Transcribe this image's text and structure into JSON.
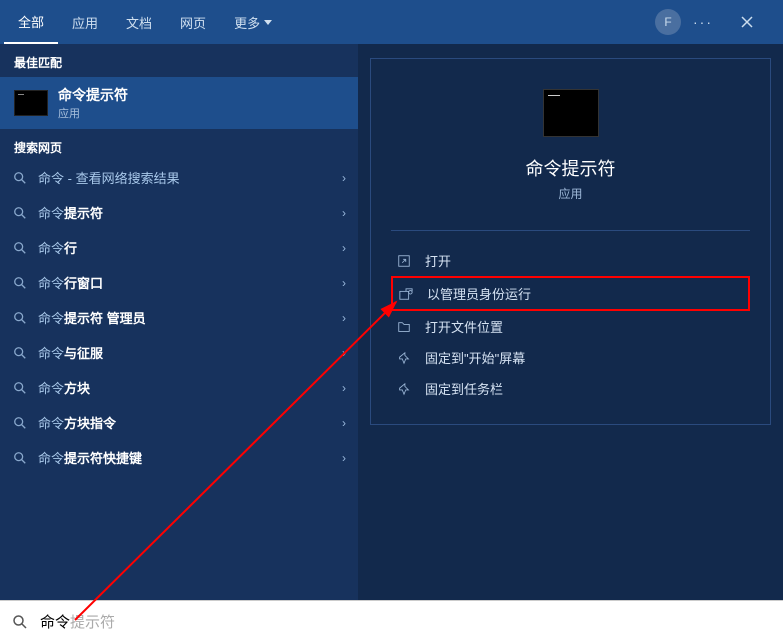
{
  "tabs": [
    "全部",
    "应用",
    "文档",
    "网页",
    "更多"
  ],
  "avatar": "F",
  "left": {
    "best_match_hdr": "最佳匹配",
    "bm_title": "命令提示符",
    "bm_sub": "应用",
    "web_hdr": "搜索网页",
    "items": [
      {
        "pre": "",
        "bold": "命令",
        "post": " - 查看网络搜索结果"
      },
      {
        "pre": "",
        "bold": "命令",
        "post": "",
        "suffix": "提示符",
        "suffix_bold": true
      },
      {
        "pre": "",
        "bold": "命令",
        "post": "",
        "suffix": "行",
        "suffix_bold": true
      },
      {
        "pre": "",
        "bold": "命令",
        "post": "",
        "suffix": "行窗口",
        "suffix_bold": true
      },
      {
        "pre": "",
        "bold": "命令",
        "post": "",
        "suffix": "提示符 管理员",
        "suffix_bold": true
      },
      {
        "pre": "",
        "bold": "命令",
        "post": "",
        "suffix": "与征服",
        "suffix_bold": true
      },
      {
        "pre": "",
        "bold": "命令",
        "post": "",
        "suffix": "方块",
        "suffix_bold": true
      },
      {
        "pre": "",
        "bold": "命令",
        "post": "",
        "suffix": "方块指令",
        "suffix_bold": true
      },
      {
        "pre": "",
        "bold": "命令",
        "post": "",
        "suffix": "提示符快捷键",
        "suffix_bold": true
      }
    ]
  },
  "right": {
    "title": "命令提示符",
    "sub": "应用",
    "actions": [
      {
        "label": "打开",
        "highlight": false
      },
      {
        "label": "以管理员身份运行",
        "highlight": true
      },
      {
        "label": "打开文件位置",
        "highlight": false
      },
      {
        "label": "固定到\"开始\"屏幕",
        "highlight": false
      },
      {
        "label": "固定到任务栏",
        "highlight": false
      }
    ]
  },
  "search": {
    "typed": "命令",
    "ghost": "提示符"
  }
}
